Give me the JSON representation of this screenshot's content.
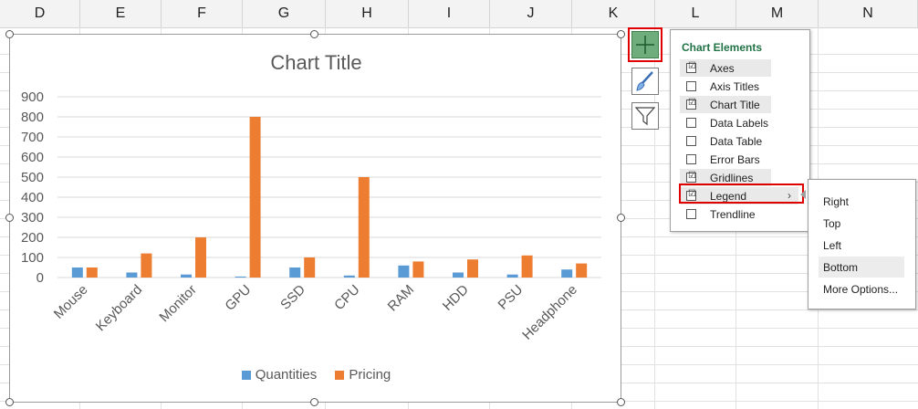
{
  "spreadsheet": {
    "columns": [
      "D",
      "E",
      "F",
      "G",
      "H",
      "I",
      "J",
      "K",
      "L",
      "M",
      "N"
    ]
  },
  "chart": {
    "title": "Chart Title",
    "legend": [
      {
        "name": "Quantities",
        "color": "#5b9bd5"
      },
      {
        "name": "Pricing",
        "color": "#ed7d31"
      }
    ]
  },
  "chart_data": {
    "type": "bar",
    "title": "Chart Title",
    "categories": [
      "Mouse",
      "Keyboard",
      "Monitor",
      "GPU",
      "SSD",
      "CPU",
      "RAM",
      "HDD",
      "PSU",
      "Headphone"
    ],
    "series": [
      {
        "name": "Quantities",
        "color": "#5b9bd5",
        "values": [
          50,
          25,
          15,
          5,
          50,
          10,
          60,
          25,
          15,
          40
        ]
      },
      {
        "name": "Pricing",
        "color": "#ed7d31",
        "values": [
          50,
          120,
          200,
          800,
          100,
          500,
          80,
          90,
          110,
          70
        ]
      }
    ],
    "ylim": [
      0,
      900
    ],
    "yticks": [
      0,
      100,
      200,
      300,
      400,
      500,
      600,
      700,
      800,
      900
    ],
    "xlabel": "",
    "ylabel": "",
    "grid": true,
    "legend_position": "bottom"
  },
  "side_buttons": {
    "chart_elements_icon": "plus-icon",
    "chart_styles_icon": "paintbrush-icon",
    "chart_filters_icon": "funnel-icon",
    "accent_color": "#70ad7d"
  },
  "chart_elements_panel": {
    "title": "Chart Elements",
    "items": [
      {
        "label": "Axes",
        "checked": "☑"
      },
      {
        "label": "Axis Titles",
        "checked": ""
      },
      {
        "label": "Chart Title",
        "checked": "☑"
      },
      {
        "label": "Data Labels",
        "checked": ""
      },
      {
        "label": "Data Table",
        "checked": ""
      },
      {
        "label": "Error Bars",
        "checked": ""
      },
      {
        "label": "Gridlines",
        "checked": "☑"
      },
      {
        "label": "Legend",
        "checked": "☑"
      },
      {
        "label": "Trendline",
        "checked": ""
      }
    ],
    "legend_arrow": "›"
  },
  "legend_submenu": {
    "items": [
      {
        "label": "Right"
      },
      {
        "label": "Top"
      },
      {
        "label": "Left"
      },
      {
        "label": "Bottom"
      },
      {
        "label": "More Options..."
      }
    ]
  }
}
